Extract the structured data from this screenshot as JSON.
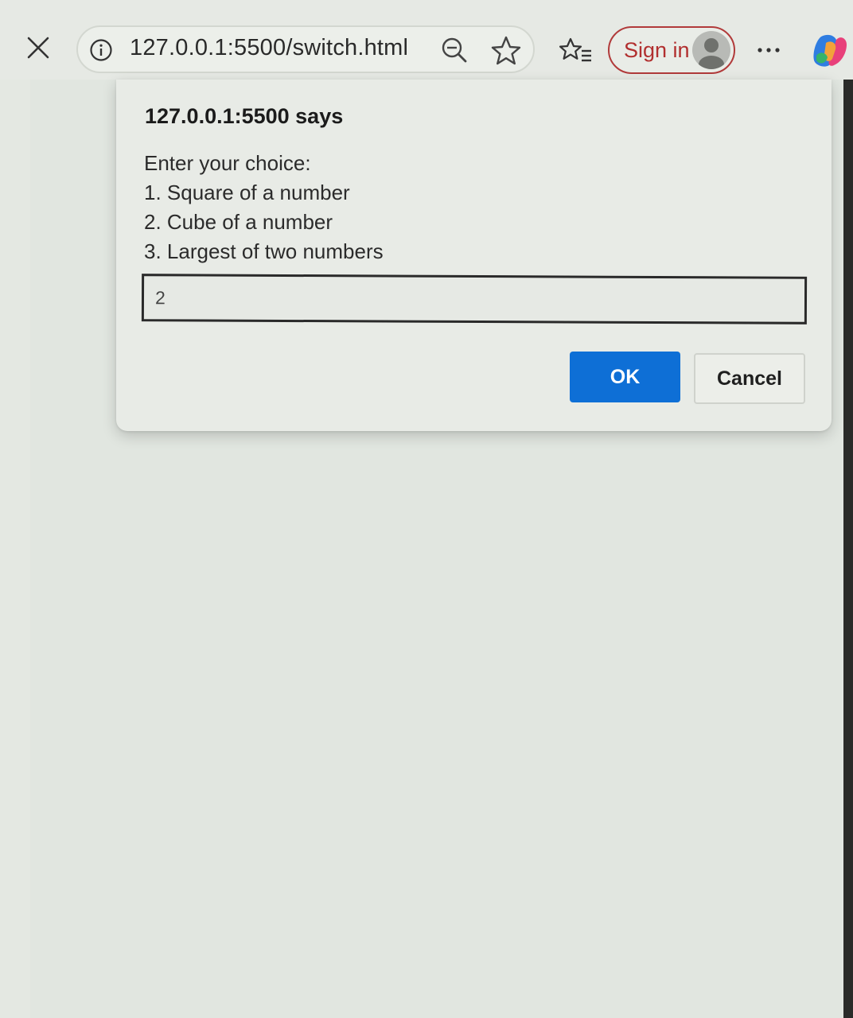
{
  "browser": {
    "address_bar": {
      "url": "127.0.0.1:5500/switch.html"
    },
    "signin_label": "Sign in",
    "icons": {
      "close": "close-icon",
      "info": "info-icon",
      "zoom": "zoom-out-icon",
      "favorite": "star-icon",
      "favorites": "favorites-list-icon",
      "avatar": "profile-avatar-icon",
      "more": "more-options-icon",
      "copilot": "copilot-icon"
    },
    "colors": {
      "signin_accent": "#b12f2f",
      "ok_button": "#0e6fd6"
    }
  },
  "dialog": {
    "title": "127.0.0.1:5500 says",
    "message_lines": [
      "Enter your choice:",
      "1. Square of a number",
      "2. Cube of a number",
      "3. Largest of two numbers"
    ],
    "input_value": "2",
    "ok_label": "OK",
    "cancel_label": "Cancel"
  }
}
